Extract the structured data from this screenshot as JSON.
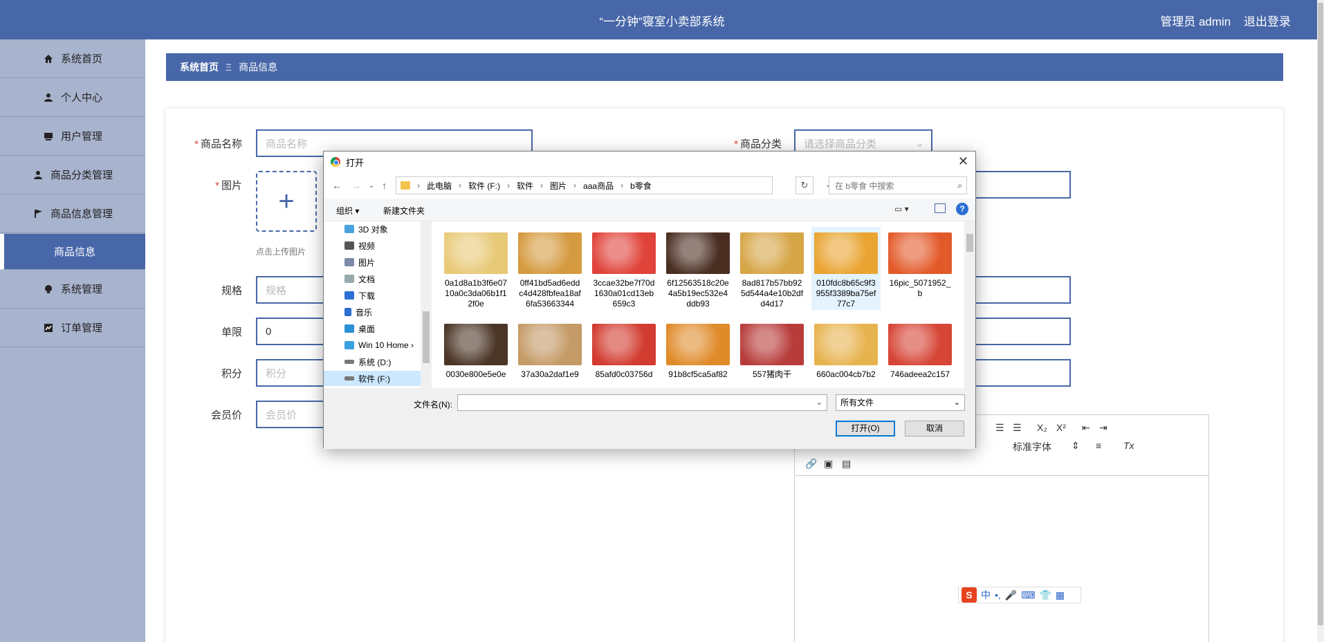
{
  "header": {
    "title": "“一分钟”寝室小卖部系统",
    "user": "管理员 admin",
    "logout": "退出登录"
  },
  "sidebar": {
    "items": [
      {
        "label": "系统首页",
        "icon": "home-icon"
      },
      {
        "label": "个人中心",
        "icon": "user-icon"
      },
      {
        "label": "用户管理",
        "icon": "monitor-icon"
      },
      {
        "label": "商品分类管理",
        "icon": "user-icon"
      },
      {
        "label": "商品信息管理",
        "icon": "flag-icon"
      },
      {
        "label": "商品信息",
        "icon": ""
      },
      {
        "label": "系统管理",
        "icon": "bulb-icon"
      },
      {
        "label": "订单管理",
        "icon": "chart-icon"
      }
    ]
  },
  "breadcrumb": {
    "home": "系统首页",
    "sep": "Ξ",
    "current": "商品信息"
  },
  "form": {
    "name_label": "商品名称",
    "name_placeholder": "商品名称",
    "category_label": "商品分类",
    "category_placeholder": "请选择商品分类",
    "image_label": "图片",
    "upload_hint": "点击上传图片",
    "spec_label": "规格",
    "spec_placeholder": "规格",
    "limit_label": "单限",
    "limit_value": "0",
    "points_label": "积分",
    "points_placeholder": "积分",
    "member_label": "会员价",
    "member_placeholder": "会员价",
    "editor_font": "标准字体"
  },
  "dialog": {
    "title": "打开",
    "path": [
      "此电脑",
      "软件 (F:)",
      "软件",
      "图片",
      "aaa商品",
      "b零食"
    ],
    "search_placeholder": "在 b零食 中搜索",
    "organize": "组织 ▾",
    "new_folder": "新建文件夹",
    "tree": [
      "3D 对象",
      "视频",
      "图片",
      "文档",
      "下载",
      "音乐",
      "桌面",
      "Win 10 Home ›",
      "系统 (D:)",
      "软件 (F:)"
    ],
    "files": [
      {
        "name": "0a1d8a1b3f6e0710a0c3da06b1f12f0e",
        "color": "#e8c977"
      },
      {
        "name": "0ff41bd5ad6eddc4d428fbfea18af6fa53663344",
        "color": "#d59a3f"
      },
      {
        "name": "3ccae32be7f70d1630a01cd13eb659c3",
        "color": "#e0433a"
      },
      {
        "name": "6f12563518c20e4a5b19ec532e4ddb93",
        "color": "#4a2e22"
      },
      {
        "name": "8ad817b57bb925d544a4e10b2dfd4d17",
        "color": "#d6a545"
      },
      {
        "name": "010fdc8b65c9f3955f3389ba75ef77c7",
        "color": "#e9a431"
      },
      {
        "name": "16pic_5071952_b",
        "color": "#e35a2a"
      },
      {
        "name": "0030e800e5e0e",
        "color": "#4b3526"
      },
      {
        "name": "37a30a2daf1e9",
        "color": "#c49a66"
      },
      {
        "name": "85afd0c03756d",
        "color": "#d23b2f"
      },
      {
        "name": "91b8cf5ca5af82",
        "color": "#e08b2a"
      },
      {
        "name": "557猪肉干",
        "color": "#b73c3a"
      },
      {
        "name": "660ac004cb7b2",
        "color": "#e7b34f"
      },
      {
        "name": "746adeea2c157",
        "color": "#d64536"
      }
    ],
    "filename_label": "文件名(N):",
    "filetype": "所有文件",
    "open_btn": "打开(O)",
    "cancel_btn": "取消"
  },
  "ime": {
    "lang": "中"
  }
}
